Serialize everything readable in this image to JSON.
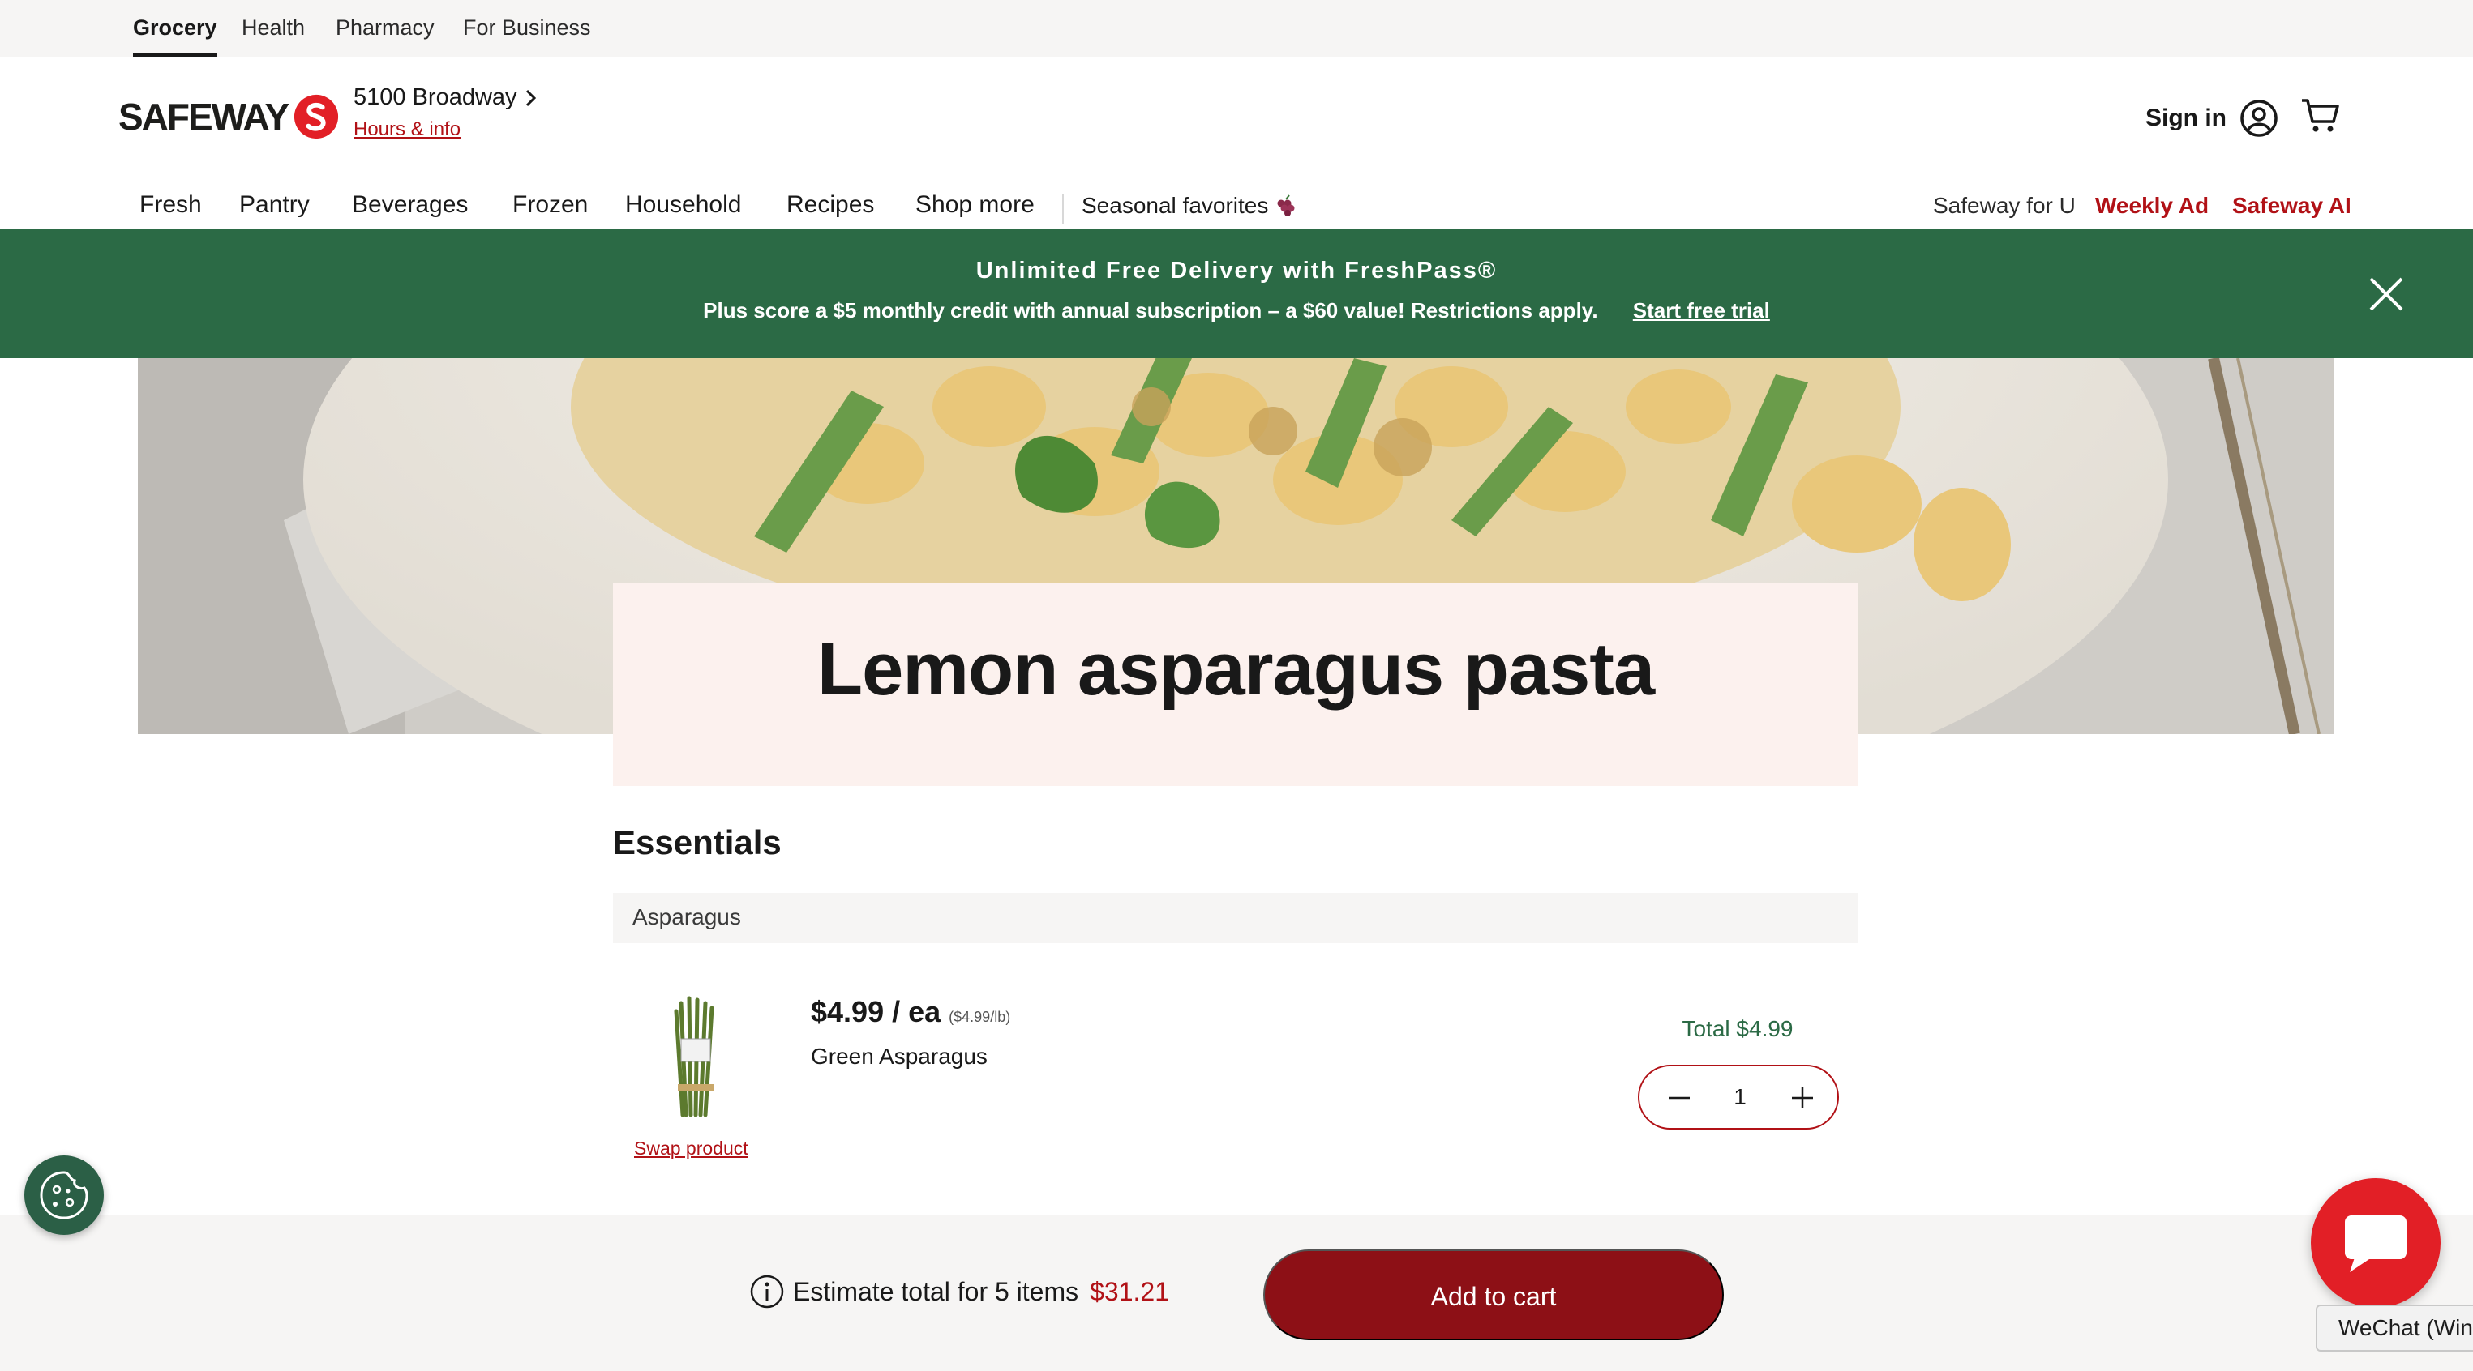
{
  "utility_tabs": [
    "Grocery",
    "Health",
    "Pharmacy",
    "For Business"
  ],
  "brand": {
    "logo_text": "SAFEWAY",
    "accent": "#b11116",
    "green": "#2b6a45"
  },
  "store": {
    "name": "5100 Broadway",
    "hours_link": "Hours & info"
  },
  "header": {
    "sign_in": "Sign in",
    "icons": [
      "account-icon",
      "cart-icon"
    ]
  },
  "nav": {
    "items": [
      "Fresh",
      "Pantry",
      "Beverages",
      "Frozen",
      "Household",
      "Recipes",
      "Shop more"
    ],
    "seasonal": "Seasonal favorites",
    "right_links": [
      "Safeway for U",
      "Weekly Ad",
      "Safeway AI"
    ]
  },
  "banner": {
    "title": "Unlimited Free Delivery with FreshPass®",
    "subtitle": "Plus score a $5 monthly credit with annual subscription – a $60 value! Restrictions apply.",
    "cta": "Start free trial"
  },
  "recipe": {
    "title": "Lemon asparagus pasta"
  },
  "essentials": {
    "heading": "Essentials",
    "group": "Asparagus",
    "product": {
      "price": "$4.99 / ea",
      "unit_price": "($4.99/lb)",
      "name": "Green Asparagus",
      "swap": "Swap product",
      "total": "Total $4.99",
      "quantity": "1"
    }
  },
  "footer": {
    "estimate_label": "Estimate total for 5 items",
    "estimate_amount": "$31.21",
    "add_button": "Add to cart"
  },
  "wechat_tooltip": "WeChat (Win"
}
